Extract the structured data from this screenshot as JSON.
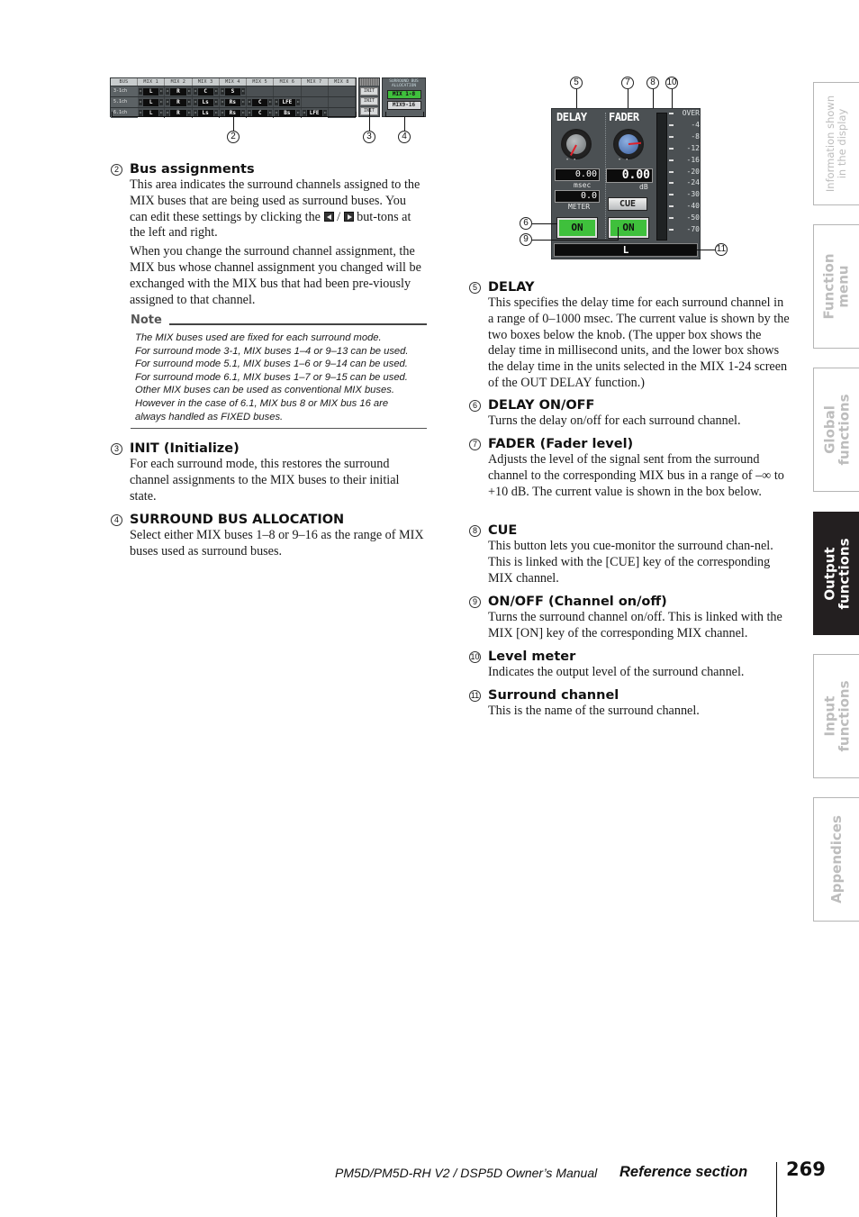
{
  "figure_bus": {
    "header": [
      "BUS",
      "MIX 1",
      "MIX 2",
      "MIX 3",
      "MIX 4",
      "MIX 5",
      "MIX 6",
      "MIX 7",
      "MIX 8"
    ],
    "rows": [
      {
        "label": "3-1ch",
        "cells": [
          "L",
          "R",
          "C",
          "S",
          "",
          "",
          "",
          ""
        ]
      },
      {
        "label": "5.1ch",
        "cells": [
          "L",
          "R",
          "Ls",
          "Rs",
          "C",
          "LFE",
          "",
          ""
        ]
      },
      {
        "label": "6.1ch",
        "cells": [
          "L",
          "R",
          "Ls",
          "Rs",
          "C",
          "Bs",
          "LFE",
          ""
        ]
      }
    ],
    "init_label": "INIT",
    "allocation_title": "SURROUND BUS ALLOCATION",
    "allocation_options": [
      {
        "label": "MIX 1-8",
        "selected": true
      },
      {
        "label": "MIX9-16",
        "selected": false
      }
    ],
    "callouts": [
      "2",
      "3",
      "4"
    ]
  },
  "figure_strip": {
    "delay_title": "DELAY",
    "fader_title": "FADER",
    "delay_msec_value": "0.00",
    "delay_msec_unit": "msec",
    "delay_meter_value": "0.0",
    "delay_meter_unit": "METER",
    "fader_value": "0.00",
    "fader_unit": "dB",
    "cue_label": "CUE",
    "delay_on_label": "ON",
    "channel_on_label": "ON",
    "meter_scale": [
      "OVER",
      "-4",
      "-8",
      "-12",
      "-16",
      "-20",
      "-24",
      "-30",
      "-40",
      "-50",
      "-70"
    ],
    "channel_name": "L",
    "callouts": [
      "5",
      "7",
      "8",
      "10",
      "6",
      "9",
      "11"
    ],
    "colors": {
      "on_green": "#3fc03c",
      "panel": "#4b5053",
      "indicator_red": "#e0202a"
    }
  },
  "left_column": {
    "bus_assignments": {
      "num": "2",
      "title": "Bus assignments",
      "p1_a": "This area indicates the surround channels assigned to the MIX buses that are being used as surround buses. You can edit these settings by clicking the",
      "p1_sep": " / ",
      "p1_b": " but-tons at the left and right.",
      "p2": "When you change the surround channel assignment, the MIX bus whose channel assignment you changed will be exchanged with the MIX bus that had been pre-viously assigned to that channel."
    },
    "note": {
      "title": "Note",
      "lines": [
        "The MIX buses used are fixed for each surround mode.",
        "For surround mode 3-1, MIX buses 1–4 or 9–13 can be used.",
        "For surround mode 5.1, MIX buses 1–6 or 9–14 can be used.",
        "For surround mode 6.1, MIX buses 1–7 or 9–15 can be used.",
        "Other MIX buses can be used as conventional MIX buses.",
        "However in the case of 6.1, MIX bus 8 or MIX bus 16 are",
        "always handled as FIXED buses."
      ]
    },
    "init": {
      "num": "3",
      "title": "INIT (Initialize)",
      "body": "For each surround mode, this restores the surround channel assignments to the MIX buses to their initial state."
    },
    "allocation": {
      "num": "4",
      "title": "SURROUND BUS ALLOCATION",
      "body": "Select either MIX buses 1–8 or 9–16 as the range of MIX buses used as surround buses."
    }
  },
  "right_column": [
    {
      "num": "5",
      "title": "DELAY",
      "body": "This specifies the delay time for each surround channel in a range of 0–1000 msec. The current value is shown by the two boxes below the knob. (The upper box shows the delay time in millisecond units, and the lower box shows the delay time in the units selected in the MIX 1-24 screen of the OUT DELAY function.)"
    },
    {
      "num": "6",
      "title": "DELAY ON/OFF",
      "body": "Turns the delay on/off for each surround channel."
    },
    {
      "num": "7",
      "title": "FADER (Fader level)",
      "body": "Adjusts the level of the signal sent from the surround channel to the corresponding MIX bus in a range of –∞ to +10 dB. The current value is shown in the box below."
    },
    {
      "num": "8",
      "title": "CUE",
      "body": "This button lets you cue-monitor the surround chan-nel. This is linked with the [CUE] key of the corresponding MIX channel."
    },
    {
      "num": "9",
      "title": "ON/OFF (Channel on/off)",
      "body": "Turns the surround channel on/off. This is linked with the MIX [ON] key of the corresponding MIX channel."
    },
    {
      "num": "10",
      "title": "Level meter",
      "body": "Indicates the output level of the surround channel."
    },
    {
      "num": "11",
      "title": "Surround channel",
      "body": "This is the name of the surround channel."
    }
  ],
  "side_tabs": [
    {
      "label_1": "Information shown",
      "label_2": "in the display",
      "active": false
    },
    {
      "label_1": "Function",
      "label_2": "menu",
      "active": false
    },
    {
      "label_1": "Global",
      "label_2": "functions",
      "active": false
    },
    {
      "label_1": "Output",
      "label_2": "functions",
      "active": true
    },
    {
      "label_1": "Input",
      "label_2": "functions",
      "active": false
    },
    {
      "label_1": "Appendices",
      "label_2": "",
      "active": false
    }
  ],
  "footer": {
    "manual": "PM5D/PM5D-RH V2 / DSP5D Owner’s Manual",
    "section": "Reference section",
    "page": "269"
  }
}
